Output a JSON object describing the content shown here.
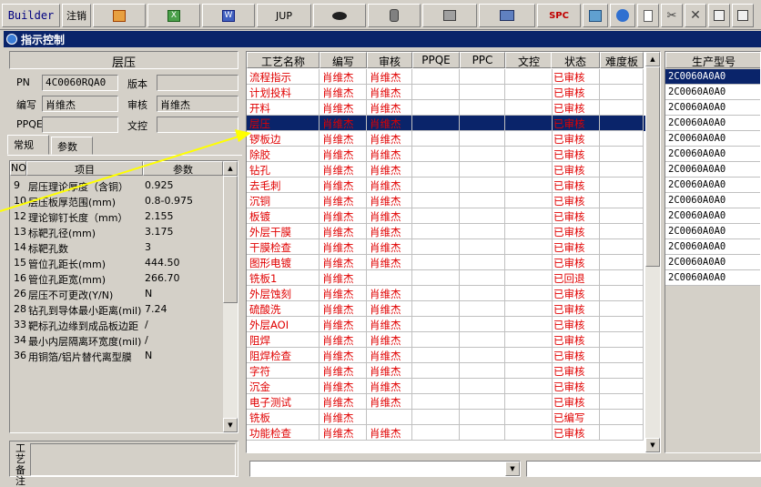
{
  "toolbar": {
    "builder": "Builder",
    "cancel": "注销",
    "jup": "JUP",
    "spc": "SPC"
  },
  "window": {
    "title": "指示控制"
  },
  "left": {
    "header": "层压",
    "pn_label": "PN",
    "pn_value": "4C0060RQA0",
    "version_label": "版本",
    "version_value": "",
    "author_label": "编写",
    "author_value": "肖维杰",
    "review_label": "审核",
    "review_value": "肖维杰",
    "ppqe_label": "PPQE",
    "ppqe_value": "",
    "control_label": "文控",
    "control_value": "",
    "tabs": [
      "常规",
      "参数"
    ],
    "param_headers": {
      "no": "NO",
      "item": "项目",
      "param": "参数"
    },
    "params": [
      {
        "no": "9",
        "item": "层压理论厚度（含铜）",
        "param": "0.925"
      },
      {
        "no": "10",
        "item": "层压板厚范围(mm)",
        "param": "0.8-0.975"
      },
      {
        "no": "12",
        "item": "理论铆钉长度（mm）",
        "param": "2.155"
      },
      {
        "no": "13",
        "item": "标靶孔径(mm)",
        "param": "3.175"
      },
      {
        "no": "14",
        "item": "标靶孔数",
        "param": "3"
      },
      {
        "no": "15",
        "item": "管位孔距长(mm)",
        "param": "444.50"
      },
      {
        "no": "16",
        "item": "管位孔距宽(mm)",
        "param": "266.70"
      },
      {
        "no": "26",
        "item": "层压不可更改(Y/N)",
        "param": "N"
      },
      {
        "no": "28",
        "item": "钻孔到导体最小距离(mil)",
        "param": "7.24"
      },
      {
        "no": "33",
        "item": "靶标孔边缘到成品板边距",
        "param": "/"
      },
      {
        "no": "34",
        "item": "最小内层隔离环宽度(mil)",
        "param": "/"
      },
      {
        "no": "36",
        "item": "用铜箔/铝片替代离型膜",
        "param": "N"
      }
    ],
    "memo_label": "工艺备注"
  },
  "grid": {
    "headers": [
      "工艺名称",
      "编写",
      "审核",
      "PPQE",
      "PPC",
      "文控",
      "状态",
      "难度板"
    ],
    "rows": [
      {
        "name": "流程指示",
        "author": "肖维杰",
        "review": "肖维杰",
        "status": "已审核"
      },
      {
        "name": "计划投料",
        "author": "肖维杰",
        "review": "肖维杰",
        "status": "已审核"
      },
      {
        "name": "开料",
        "author": "肖维杰",
        "review": "肖维杰",
        "status": "已审核"
      },
      {
        "name": "层压",
        "author": "肖维杰",
        "review": "肖维杰",
        "status": "已审核"
      },
      {
        "name": "锣板边",
        "author": "肖维杰",
        "review": "肖维杰",
        "status": "已审核"
      },
      {
        "name": "除胶",
        "author": "肖维杰",
        "review": "肖维杰",
        "status": "已审核"
      },
      {
        "name": "钻孔",
        "author": "肖维杰",
        "review": "肖维杰",
        "status": "已审核"
      },
      {
        "name": "去毛刺",
        "author": "肖维杰",
        "review": "肖维杰",
        "status": "已审核"
      },
      {
        "name": "沉铜",
        "author": "肖维杰",
        "review": "肖维杰",
        "status": "已审核"
      },
      {
        "name": "板镀",
        "author": "肖维杰",
        "review": "肖维杰",
        "status": "已审核"
      },
      {
        "name": "外层干膜",
        "author": "肖维杰",
        "review": "肖维杰",
        "status": "已审核"
      },
      {
        "name": "干膜检查",
        "author": "肖维杰",
        "review": "肖维杰",
        "status": "已审核"
      },
      {
        "name": "图形电镀",
        "author": "肖维杰",
        "review": "肖维杰",
        "status": "已审核"
      },
      {
        "name": "铣板1",
        "author": "肖维杰",
        "review": "",
        "status": "已回退"
      },
      {
        "name": "外层蚀刻",
        "author": "肖维杰",
        "review": "肖维杰",
        "status": "已审核"
      },
      {
        "name": "硫酸洗",
        "author": "肖维杰",
        "review": "肖维杰",
        "status": "已审核"
      },
      {
        "name": "外层AOI",
        "author": "肖维杰",
        "review": "肖维杰",
        "status": "已审核"
      },
      {
        "name": "阻焊",
        "author": "肖维杰",
        "review": "肖维杰",
        "status": "已审核"
      },
      {
        "name": "阻焊检查",
        "author": "肖维杰",
        "review": "肖维杰",
        "status": "已审核"
      },
      {
        "name": "字符",
        "author": "肖维杰",
        "review": "肖维杰",
        "status": "已审核"
      },
      {
        "name": "沉金",
        "author": "肖维杰",
        "review": "肖维杰",
        "status": "已审核"
      },
      {
        "name": "电子测试",
        "author": "肖维杰",
        "review": "肖维杰",
        "status": "已审核"
      },
      {
        "name": "铣板",
        "author": "肖维杰",
        "review": "",
        "status": "已编写"
      },
      {
        "name": "功能检查",
        "author": "肖维杰",
        "review": "肖维杰",
        "status": "已审核"
      }
    ],
    "selected_index": 3
  },
  "right": {
    "header": "生产型号",
    "rows": [
      "2C0060A0A0",
      "2C0060A0A0",
      "2C0060A0A0",
      "2C0060A0A0",
      "2C0060A0A0",
      "2C0060A0A0",
      "2C0060A0A0",
      "2C0060A0A0",
      "2C0060A0A0",
      "2C0060A0A0",
      "2C0060A0A0",
      "2C0060A0A0",
      "2C0060A0A0",
      "2C0060A0A0"
    ]
  },
  "colors": {
    "selection": "#0a246a",
    "row_text": "#e00000",
    "arrow": "#ffff00"
  }
}
